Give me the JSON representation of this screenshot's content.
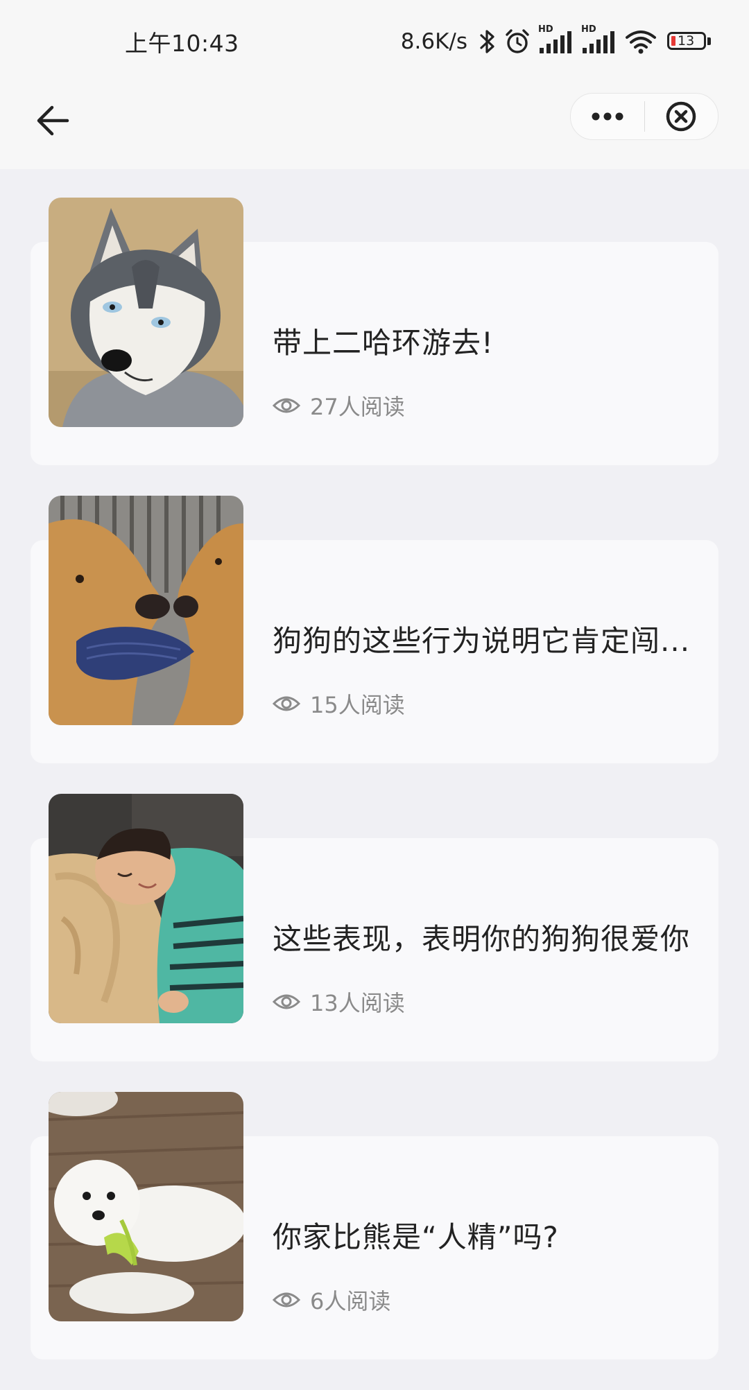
{
  "status_bar": {
    "time": "上午10:43",
    "net_speed": "8.6K/s",
    "battery_level": "13",
    "signal_labels": [
      "HD",
      "HD"
    ],
    "icons": [
      "bluetooth-icon",
      "alarm-icon",
      "signal-icon",
      "signal-icon",
      "wifi-icon",
      "battery-icon"
    ]
  },
  "nav": {
    "icons": [
      "back-arrow-icon",
      "more-dots-icon",
      "close-circle-icon"
    ]
  },
  "articles": [
    {
      "title": "带上二哈环游去!",
      "views": "27人阅读",
      "image": "husky-photo"
    },
    {
      "title": "狗狗的这些行为说明它肯定闯...",
      "views": "15人阅读",
      "image": "golden-retrievers-photo"
    },
    {
      "title": "这些表现，表明你的狗狗很爱你",
      "views": "13人阅读",
      "image": "boy-hugging-dog-photo"
    },
    {
      "title": "你家比熊是“人精”吗?",
      "views": "6人阅读",
      "image": "bichon-photo"
    }
  ],
  "colors": {
    "background": "#f0f0f4",
    "card": "#f9f9fb",
    "title_text": "#222222",
    "meta_text": "#8a8a8a",
    "battery_low": "#e53935"
  }
}
